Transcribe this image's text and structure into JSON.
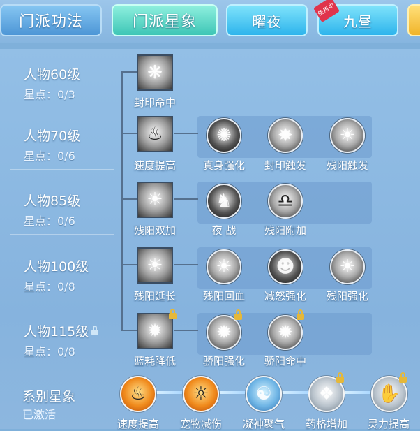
{
  "tabs": [
    {
      "label": "门派功法",
      "state": "normal"
    },
    {
      "label": "门派星象",
      "state": "selected"
    },
    {
      "label": "曜夜",
      "state": "normal"
    },
    {
      "label": "九昼",
      "badge": "使用中",
      "state": "active"
    }
  ],
  "levels": [
    {
      "title": "人物60级",
      "points": "星点：0/3"
    },
    {
      "title": "人物70级",
      "points": "星点：0/6"
    },
    {
      "title": "人物85级",
      "points": "星点：0/6"
    },
    {
      "title": "人物100级",
      "points": "星点：0/8"
    },
    {
      "title": "人物115级",
      "points": "星点：0/8",
      "locked": true
    }
  ],
  "rows": [
    {
      "main": {
        "label": "封印命中",
        "icon": "bird-swirl-icon"
      },
      "subs": []
    },
    {
      "main": {
        "label": "速度提高",
        "icon": "boot-flame-icon"
      },
      "subs": [
        {
          "label": "真身强化",
          "icon": "phoenix-icon"
        },
        {
          "label": "封印触发",
          "icon": "wing-burst-icon"
        },
        {
          "label": "残阳触发",
          "icon": "sun-ray-icon"
        }
      ]
    },
    {
      "main": {
        "label": "残阳双加",
        "icon": "sun-ray-icon"
      },
      "subs": [
        {
          "label": "夜 战",
          "icon": "warrior-silhouette-icon"
        },
        {
          "label": "残阳附加",
          "icon": "bell-icon"
        }
      ]
    },
    {
      "main": {
        "label": "残阳延长",
        "icon": "sun-ray-icon"
      },
      "subs": [
        {
          "label": "残阳回血",
          "icon": "sun-ray-icon"
        },
        {
          "label": "减怒强化",
          "icon": "angry-face-icon"
        },
        {
          "label": "残阳强化",
          "icon": "sun-ray-icon"
        }
      ]
    },
    {
      "main": {
        "label": "蓝耗降低",
        "icon": "vortex-icon",
        "locked": true
      },
      "subs": [
        {
          "label": "骄阳强化",
          "icon": "vortex-icon",
          "locked": true
        },
        {
          "label": "骄阳命中",
          "icon": "vortex-icon",
          "locked": true
        }
      ]
    }
  ],
  "constellation": {
    "title": "系别星象",
    "status": "已激活",
    "nodes": [
      {
        "label": "速度提高",
        "style": "fire",
        "icon": "boot-flame-icon"
      },
      {
        "label": "宠物减伤",
        "style": "fire",
        "icon": "fire-spirit-icon"
      },
      {
        "label": "凝神聚气",
        "style": "water",
        "icon": "meditating-figure-icon"
      },
      {
        "label": "药格增加",
        "style": "grey",
        "icon": "potion-icon",
        "locked": true
      },
      {
        "label": "灵力提高",
        "style": "grey",
        "icon": "hand-glow-icon",
        "locked": true
      }
    ]
  }
}
